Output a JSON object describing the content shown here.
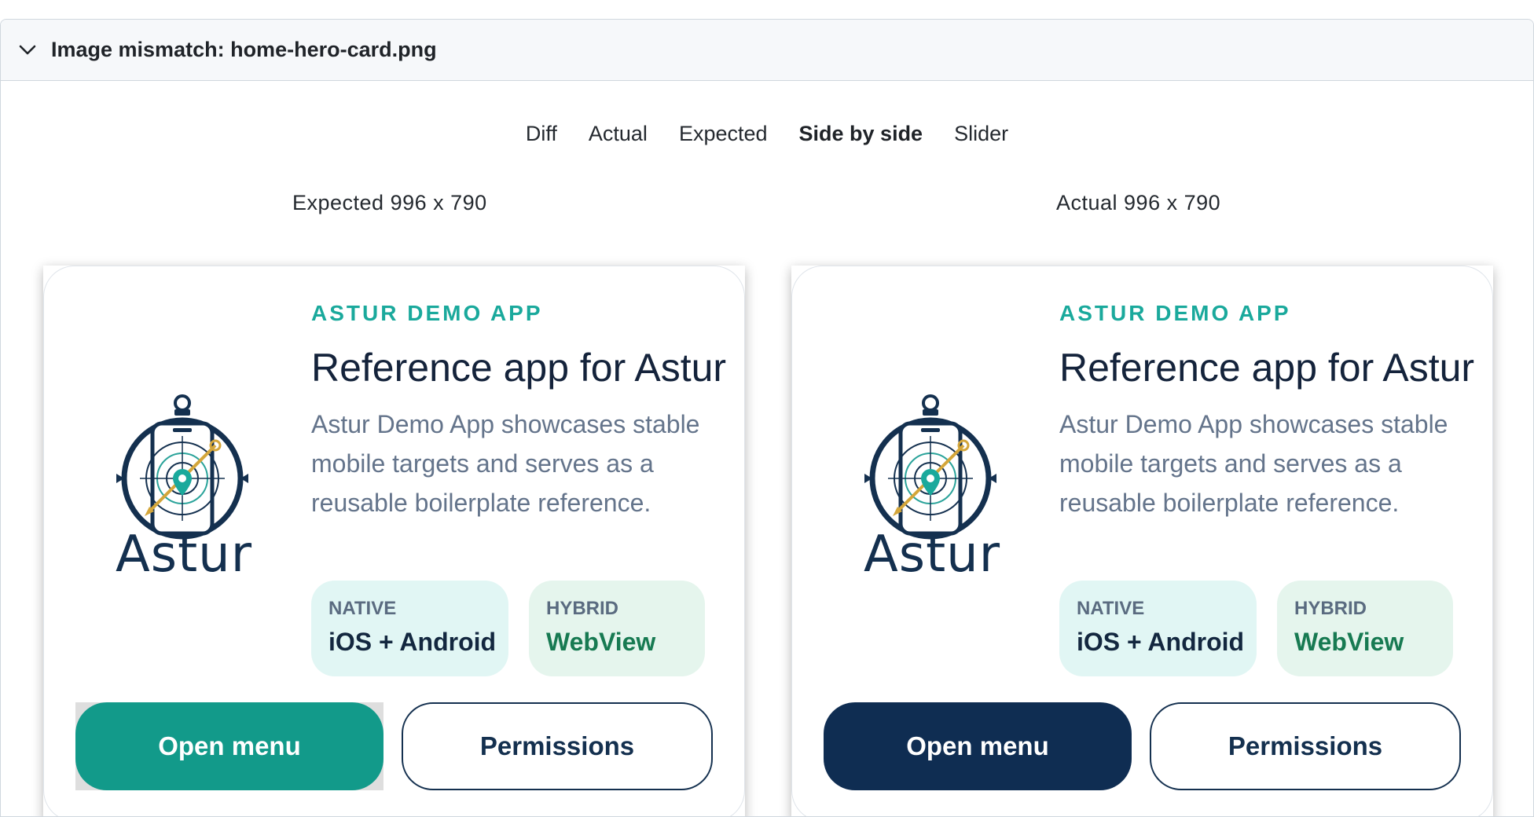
{
  "panel": {
    "title": "Image mismatch: home-hero-card.png",
    "chevron_icon": "chevron-down-icon"
  },
  "tabs": [
    {
      "label": "Diff",
      "active": false
    },
    {
      "label": "Actual",
      "active": false
    },
    {
      "label": "Expected",
      "active": false
    },
    {
      "label": "Side by side",
      "active": true
    },
    {
      "label": "Slider",
      "active": false
    }
  ],
  "expected": {
    "size_label": "Expected 996 x 790",
    "primary_button_color": "#129a8a"
  },
  "actual": {
    "size_label": "Actual 996 x 790",
    "primary_button_color": "#0f2d52"
  },
  "card": {
    "logo_text": "Astur",
    "eyebrow": "ASTUR DEMO APP",
    "headline": "Reference app for Astur",
    "description": "Astur Demo App showcases stable mobile targets and serves as a reusable boilerplate reference.",
    "chips": [
      {
        "label": "NATIVE",
        "value": "iOS + Android"
      },
      {
        "label": "HYBRID",
        "value": "WebView"
      }
    ],
    "primary_button": "Open menu",
    "secondary_button": "Permissions"
  },
  "colors": {
    "accent_teal": "#1aa99c",
    "navy": "#14304f",
    "hybrid_green": "#177a52"
  }
}
